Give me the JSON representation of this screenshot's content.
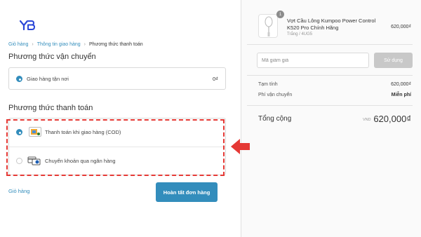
{
  "brand": {
    "logo_text": "YB",
    "accent": "#338dbc",
    "logo_color": "#2b47d8"
  },
  "breadcrumb": {
    "items": [
      "Giỏ hàng",
      "Thông tin giao hàng",
      "Phương thức thanh toán"
    ],
    "separator": "›"
  },
  "shipping": {
    "title": "Phương thức vận chuyển",
    "option_label": "Giao hàng tận nơi",
    "option_price": "0₫",
    "selected": true
  },
  "payment": {
    "title": "Phương thức thanh toán",
    "options": [
      {
        "label": "Thanh toán khi giao hàng (COD)",
        "icon": "cod-icon",
        "selected": true
      },
      {
        "label": "Chuyển khoản qua ngân hàng",
        "icon": "bank-transfer-icon",
        "selected": false
      }
    ]
  },
  "actions": {
    "back_label": "Giỏ hàng",
    "complete_label": "Hoàn tất đơn hàng"
  },
  "annotation": {
    "highlight_color": "#e53935"
  },
  "order": {
    "product": {
      "name": "Vợt Cầu Lông Kumpoo Power Control K520 Pro Chính Hãng",
      "variant": "Trắng / 4UG5",
      "price": "620,000₫",
      "quantity": "1"
    },
    "discount": {
      "placeholder": "Mã giảm giá",
      "button_label": "Sử dụng"
    },
    "subtotal_label": "Tạm tính",
    "subtotal_value": "620,000₫",
    "shipping_label": "Phí vận chuyển",
    "shipping_value": "Miễn phí",
    "total_label": "Tổng cộng",
    "currency": "VND",
    "total_value": "620,000₫"
  }
}
